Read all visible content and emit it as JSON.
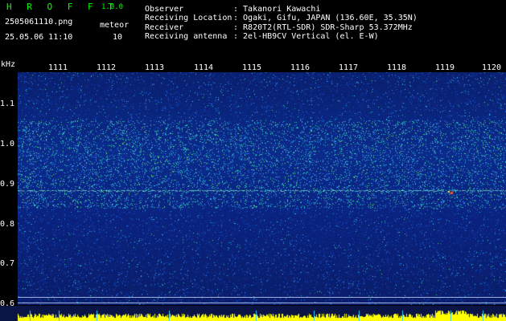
{
  "header": {
    "app_name": "H R O F F T",
    "app_version": "1.0.0",
    "filename": "2505061110.png",
    "datetime": "25.05.06 11:10",
    "meteor_label": "meteor",
    "meteor_count": "10",
    "observer_label": "Observer",
    "observer_value": ": Takanori Kawachi",
    "location_label": "Receiving Location",
    "location_value": ": Ogaki, Gifu, JAPAN (136.60E, 35.35N)",
    "receiver_label": "Receiver",
    "receiver_value": ": R820T2(RTL-SDR) SDR-Sharp 53.372MHz",
    "antenna_label": "Receiving antenna",
    "antenna_value": ": 2el-HB9CV Vertical (el. E-W)"
  },
  "axes": {
    "y_unit": "kHz",
    "minute_ticks": [
      "1111",
      "1112",
      "1113",
      "1114",
      "1115",
      "1116",
      "1117",
      "1118",
      "1119",
      "1120"
    ],
    "freq_ticks": [
      "1.1",
      "1.0",
      "0.9",
      "0.8",
      "0.7",
      "0.6"
    ]
  },
  "colors": {
    "background": "#000000",
    "spectrogram_base": "#0b2a8a",
    "header_accent": "#00ff00",
    "activity_bar": "#ffff00"
  }
}
